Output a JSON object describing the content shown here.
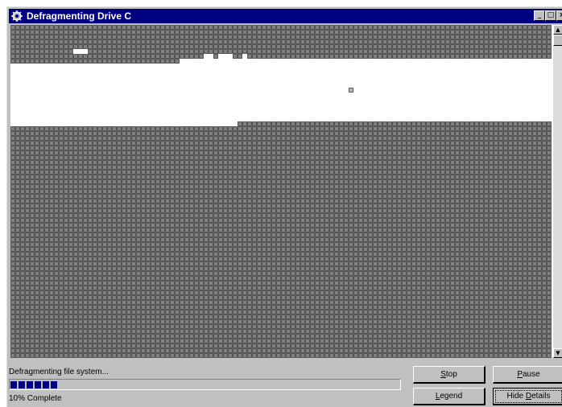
{
  "window": {
    "title": "Defragmenting Drive C",
    "controls": {
      "minimize": "_",
      "maximize": "□",
      "close": "×"
    }
  },
  "icons": {
    "app": "defrag-gear-icon",
    "scroll_up": "arrow-up-icon",
    "scroll_down": "arrow-down-icon"
  },
  "colors": {
    "title_bar": "#000080",
    "cluster_used": "#7f7f7f",
    "cluster_free": "#ffffff",
    "cluster_highlight": "#b8b8b8",
    "progress_fill": "#000080"
  },
  "status": {
    "message": "Defragmenting file system...",
    "percent_label": "10% Complete",
    "progress": 0.1
  },
  "buttons": {
    "stop": {
      "mnemonic": "S",
      "rest": "top"
    },
    "pause": {
      "mnemonic": "P",
      "rest": "ause"
    },
    "legend": {
      "mnemonic": "L",
      "rest": "egend"
    },
    "hide_details": {
      "prefix": "Hide ",
      "mnemonic": "D",
      "rest": "etails"
    }
  }
}
